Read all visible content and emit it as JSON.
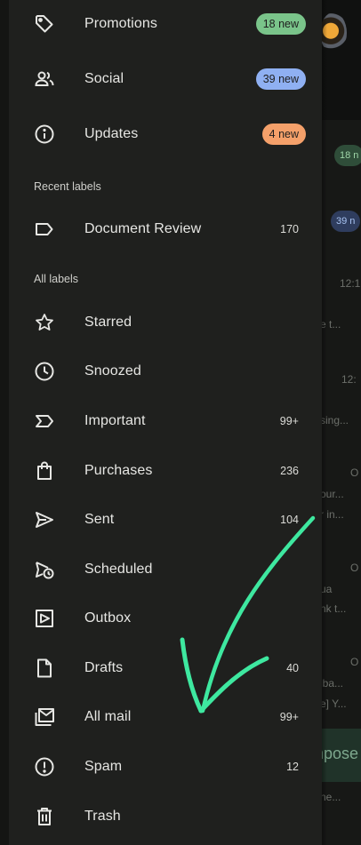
{
  "background": {
    "chips": [
      "18 n",
      "39 n"
    ],
    "texts": [
      "12:1",
      "e t...",
      "12:",
      "sing...",
      "O",
      "our...",
      "r in...",
      "O",
      "ua",
      "nk t...",
      "O",
      "lba...",
      "e] Y...",
      "npose",
      "ne..."
    ]
  },
  "drawer": {
    "categories": [
      {
        "label": "Promotions",
        "badge": "18 new",
        "icon": "tag-icon"
      },
      {
        "label": "Social",
        "badge": "39 new",
        "icon": "people-icon"
      },
      {
        "label": "Updates",
        "badge": "4 new",
        "icon": "info-icon"
      }
    ],
    "recent_labels_title": "Recent labels",
    "recent_labels": [
      {
        "label": "Document Review",
        "count": "170",
        "icon": "label-icon"
      }
    ],
    "all_labels_title": "All labels",
    "labels": [
      {
        "label": "Starred",
        "count": "",
        "icon": "star-icon"
      },
      {
        "label": "Snoozed",
        "count": "",
        "icon": "clock-icon"
      },
      {
        "label": "Important",
        "count": "99+",
        "icon": "important-icon"
      },
      {
        "label": "Purchases",
        "count": "236",
        "icon": "shopping-bag-icon"
      },
      {
        "label": "Sent",
        "count": "104",
        "icon": "send-icon"
      },
      {
        "label": "Scheduled",
        "count": "",
        "icon": "scheduled-send-icon"
      },
      {
        "label": "Outbox",
        "count": "",
        "icon": "outbox-icon"
      },
      {
        "label": "Drafts",
        "count": "40",
        "icon": "draft-icon"
      },
      {
        "label": "All mail",
        "count": "99+",
        "icon": "all-mail-icon"
      },
      {
        "label": "Spam",
        "count": "12",
        "icon": "spam-icon"
      },
      {
        "label": "Trash",
        "count": "",
        "icon": "trash-icon"
      }
    ]
  },
  "colors": {
    "drawer_bg": "#1f201e",
    "annotation_arrow": "#3ee8a0",
    "badge_green": "#7ac48a",
    "badge_blue": "#8fb0f2",
    "badge_orange": "#f4a06a"
  }
}
